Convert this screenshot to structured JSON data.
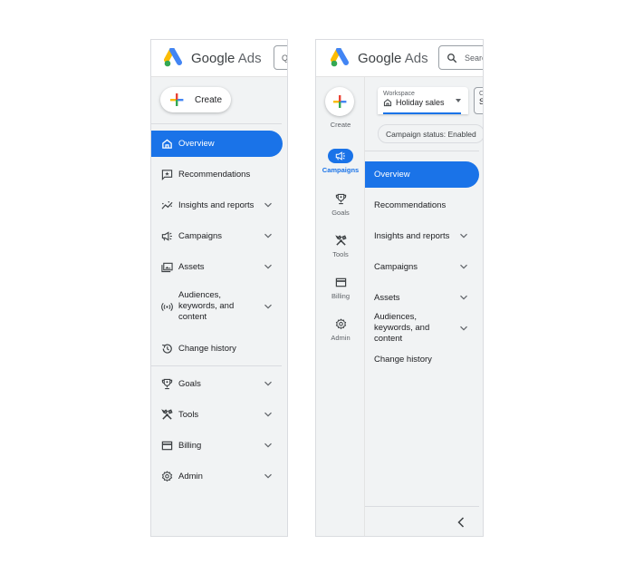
{
  "brand": {
    "name_google": "Google",
    "name_ads": "Ads"
  },
  "colors": {
    "accent": "#1a73e8",
    "panel_bg": "#f1f3f4",
    "text": "#202124",
    "muted": "#5f6368"
  },
  "expanded_nav": {
    "search_placeholder": "Q",
    "create_label": "Create",
    "items": [
      {
        "label": "Overview",
        "icon": "home-icon",
        "active": true
      },
      {
        "label": "Recommendations",
        "icon": "recommendations-icon"
      },
      {
        "label": "Insights and reports",
        "icon": "insights-icon",
        "expandable": true
      },
      {
        "label": "Campaigns",
        "icon": "campaigns-icon",
        "expandable": true
      },
      {
        "label": "Assets",
        "icon": "assets-icon",
        "expandable": true
      },
      {
        "label": "Audiences, keywords, and content",
        "icon": "audiences-icon",
        "expandable": true
      },
      {
        "label": "Change history",
        "icon": "history-icon"
      },
      {
        "label": "Goals",
        "icon": "goals-icon",
        "expandable": true
      },
      {
        "label": "Tools",
        "icon": "tools-icon",
        "expandable": true
      },
      {
        "label": "Billing",
        "icon": "billing-icon",
        "expandable": true
      },
      {
        "label": "Admin",
        "icon": "admin-icon",
        "expandable": true
      }
    ]
  },
  "rail_nav": {
    "search_placeholder": "Search",
    "create_label": "Create",
    "rail": [
      {
        "label": "Campaigns",
        "icon": "campaigns-icon",
        "selected": true
      },
      {
        "label": "Goals",
        "icon": "goals-icon"
      },
      {
        "label": "Tools",
        "icon": "tools-icon"
      },
      {
        "label": "Billing",
        "icon": "billing-icon"
      },
      {
        "label": "Admin",
        "icon": "admin-icon"
      }
    ],
    "workspace": {
      "label": "Workspace",
      "value": "Holiday sales",
      "second_label": "C",
      "second_value": "S"
    },
    "status_chip": "Campaign status: Enabled",
    "items": [
      {
        "label": "Overview",
        "active": true
      },
      {
        "label": "Recommendations"
      },
      {
        "label": "Insights and reports",
        "expandable": true
      },
      {
        "label": "Campaigns",
        "expandable": true
      },
      {
        "label": "Assets",
        "expandable": true
      },
      {
        "label": "Audiences, keywords, and content",
        "expandable": true
      },
      {
        "label": "Change history"
      }
    ]
  }
}
